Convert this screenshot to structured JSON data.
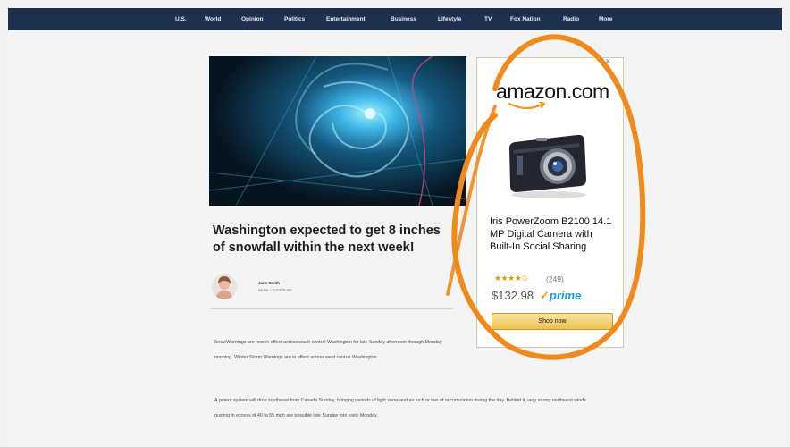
{
  "nav": {
    "items": [
      "U.S.",
      "World",
      "Opinion",
      "Politics",
      "Entertainment",
      "Business",
      "Lifestyle",
      "TV",
      "Fox Nation",
      "Radio",
      "More"
    ]
  },
  "article": {
    "headline": "Washington expected to get 8 inches of snowfall within the next week!",
    "author_name": "Jane Smith",
    "author_role": "Writer / Contributor",
    "paragraphs": [
      "SnowWarnings are now in effect across south central Washington for late Sunday afternoon through Monday morning. Winter Storm Warnings are in effect across west central Washington.",
      "A potent system will drop southeast from Canada Sunday, bringing periods of light snow and an inch or two of accumulation during the day. Behind it, very strong northwest winds gusting in excess of 40 to 55 mph are possible late Sunday into early Monday."
    ]
  },
  "ad": {
    "adchoices_label": "▷✕",
    "logo": "amazon.com",
    "product_title": "Iris PowerZoom B2100 14.1 MP Digital Camera with Built-In Social Sharing",
    "stars": "★★★★✩",
    "rating_percent": 90,
    "reviews": "(249)",
    "price": "$132.98",
    "prime_check": "✓",
    "prime_label": "prime",
    "shop_button": "Shop now"
  },
  "colors": {
    "nav_bg": "#1f2f4e",
    "annotation_orange": "#f08a1c",
    "prime_blue": "#1a9bd7",
    "button_gold": "#f0c14b"
  }
}
